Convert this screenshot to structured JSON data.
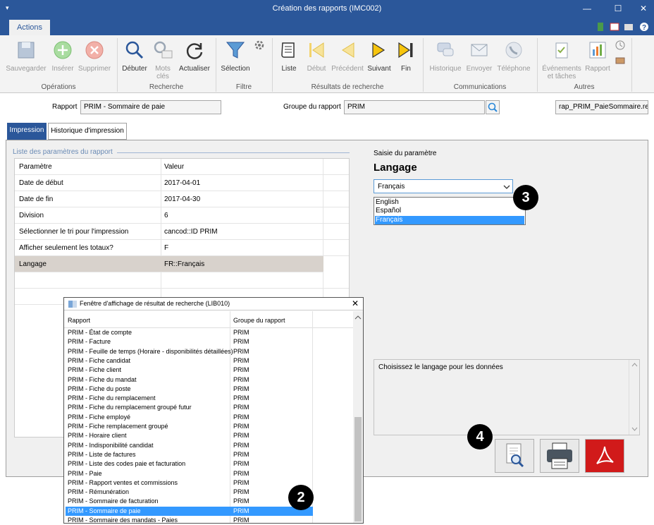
{
  "window": {
    "title": "Création des rapports (IMC002)"
  },
  "ribbon": {
    "tab": "Actions",
    "buttons": {
      "save": "Sauvegarder",
      "insert": "Insérer",
      "delete": "Supprimer",
      "search_start": "Débuter",
      "keywords_1": "Mots",
      "keywords_2": "clés",
      "refresh": "Actualiser",
      "selection": "Sélection",
      "list": "Liste",
      "first": "Début",
      "previous": "Précédent",
      "next": "Suivant",
      "last": "Fin",
      "history": "Historique",
      "send": "Envoyer",
      "phone": "Téléphone",
      "events_1": "Événements",
      "events_2": "et tâches",
      "report": "Rapport"
    },
    "groups": {
      "operations": "Opérations",
      "search": "Recherche",
      "filter": "Filtre",
      "results": "Résultats de recherche",
      "communications": "Communications",
      "others": "Autres"
    }
  },
  "header": {
    "report_label": "Rapport",
    "report_value": "PRIM - Sommaire de paie",
    "group_label": "Groupe du rapport",
    "group_value": "PRIM",
    "file_value": "rap_PRIM_PaieSommaire.re"
  },
  "tabs": [
    "Impression",
    "Historique d'impression"
  ],
  "params": {
    "legend": "Liste des paramètres du rapport",
    "col_param": "Paramètre",
    "col_value": "Valeur",
    "rows": [
      {
        "name": "Date de début",
        "value": "2017-04-01"
      },
      {
        "name": "Date de fin",
        "value": "2017-04-30"
      },
      {
        "name": "Division",
        "value": "6"
      },
      {
        "name": "Sélectionner le tri pour l'impression",
        "value": "cancod::ID PRIM"
      },
      {
        "name": "Afficher seulement les totaux?",
        "value": "F"
      },
      {
        "name": "Langage",
        "value": "FR::Français"
      }
    ]
  },
  "entry": {
    "caption": "Saisie du paramètre",
    "title": "Langage",
    "selected": "Français",
    "options": [
      "English",
      "Español",
      "Français"
    ],
    "help": "Choisissez le langage pour les données"
  },
  "popup": {
    "title": "Fenêtre d'affichage de résultat de recherche (LIB010)",
    "col_report": "Rapport",
    "col_group": "Groupe du rapport",
    "rows": [
      {
        "report": "PRIM - État de compte",
        "group": "PRIM"
      },
      {
        "report": "PRIM - Facture",
        "group": "PRIM"
      },
      {
        "report": "PRIM - Feuille de temps (Horaire - disponibilités détaillées)",
        "group": "PRIM"
      },
      {
        "report": "PRIM - Fiche candidat",
        "group": "PRIM"
      },
      {
        "report": "PRIM - Fiche client",
        "group": "PRIM"
      },
      {
        "report": "PRIM - Fiche du mandat",
        "group": "PRIM"
      },
      {
        "report": "PRIM - Fiche du poste",
        "group": "PRIM"
      },
      {
        "report": "PRIM - Fiche du remplacement",
        "group": "PRIM"
      },
      {
        "report": "PRIM - Fiche du remplacement groupé futur",
        "group": "PRIM"
      },
      {
        "report": "PRIM - Fiche employé",
        "group": "PRIM"
      },
      {
        "report": "PRIM - Fiche remplacement groupé",
        "group": "PRIM"
      },
      {
        "report": "PRIM - Horaire client",
        "group": "PRIM"
      },
      {
        "report": "PRIM - Indisponibilité candidat",
        "group": "PRIM"
      },
      {
        "report": "PRIM - Liste de factures",
        "group": "PRIM"
      },
      {
        "report": "PRIM - Liste des codes paie et facturation",
        "group": "PRIM"
      },
      {
        "report": "PRIM - Paie",
        "group": "PRIM"
      },
      {
        "report": "PRIM - Rapport ventes et commissions",
        "group": "PRIM"
      },
      {
        "report": "PRIM - Rémunération",
        "group": "PRIM"
      },
      {
        "report": "PRIM - Sommaire de facturation",
        "group": "PRIM"
      },
      {
        "report": "PRIM - Sommaire de paie",
        "group": "PRIM"
      },
      {
        "report": "PRIM - Sommaire des mandats - Paies",
        "group": "PRIM"
      }
    ]
  },
  "badges": {
    "b2": "2",
    "b3": "3",
    "b4": "4"
  },
  "colors": {
    "accent": "#2b579a",
    "selection": "#3399ff",
    "pdf_red": "#d11a1a"
  }
}
